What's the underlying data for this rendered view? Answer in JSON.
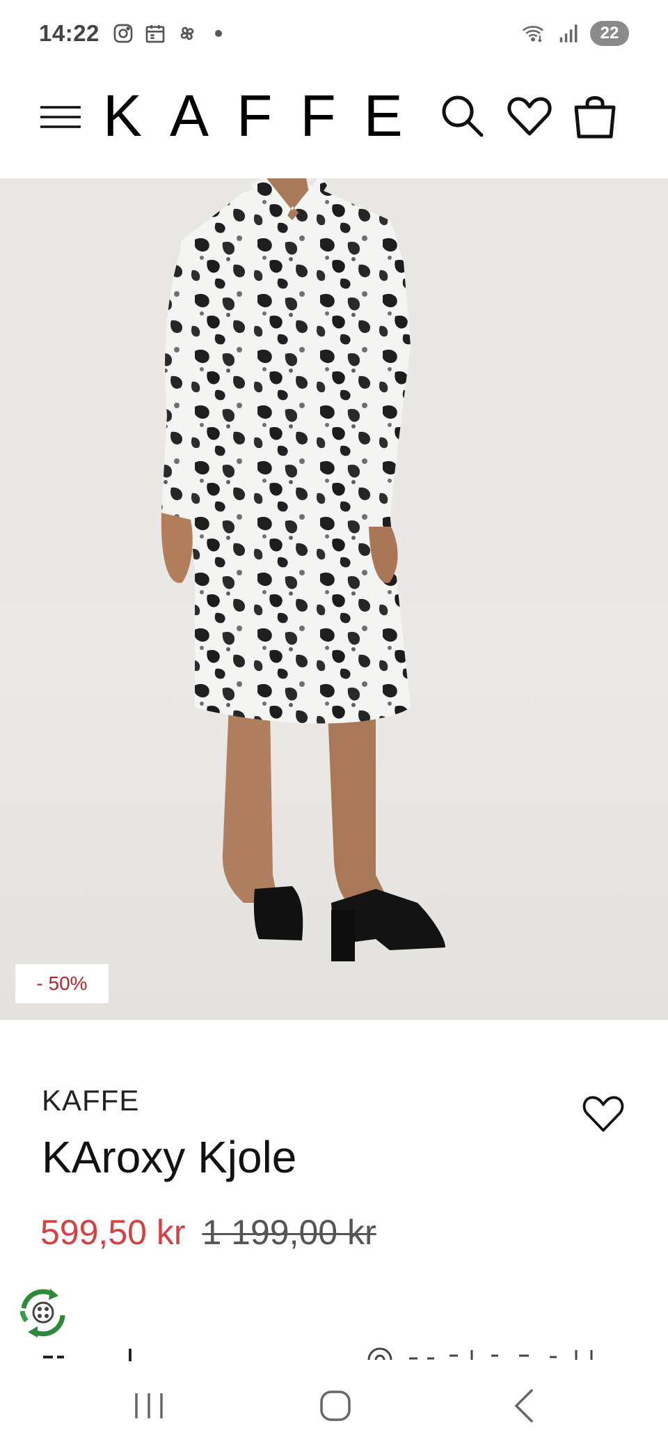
{
  "status_bar": {
    "time": "14:22",
    "left_icons": [
      "instagram-icon",
      "calendar-icon",
      "pinwheel-icon",
      "dot"
    ],
    "right_icons": [
      "wifi-icon",
      "signal-icon"
    ],
    "battery": "22"
  },
  "header": {
    "brand": "KAFFE",
    "icons": [
      "menu-icon",
      "search-icon",
      "heart-icon",
      "bag-icon"
    ]
  },
  "gallery": {
    "discount": "- 50%",
    "image_count": 12,
    "active_index": 0
  },
  "product": {
    "brand": "KAFFE",
    "title": "KAroxy Kjole",
    "price_sale": "599,50 kr",
    "price_original": "1 199,00 kr"
  },
  "colors": {
    "sale": "#d24243",
    "badge_text": "#b2282a",
    "eco_green": "#2e8a3a"
  },
  "nav": {
    "icons": [
      "recent-apps-icon",
      "home-icon",
      "back-icon"
    ]
  }
}
